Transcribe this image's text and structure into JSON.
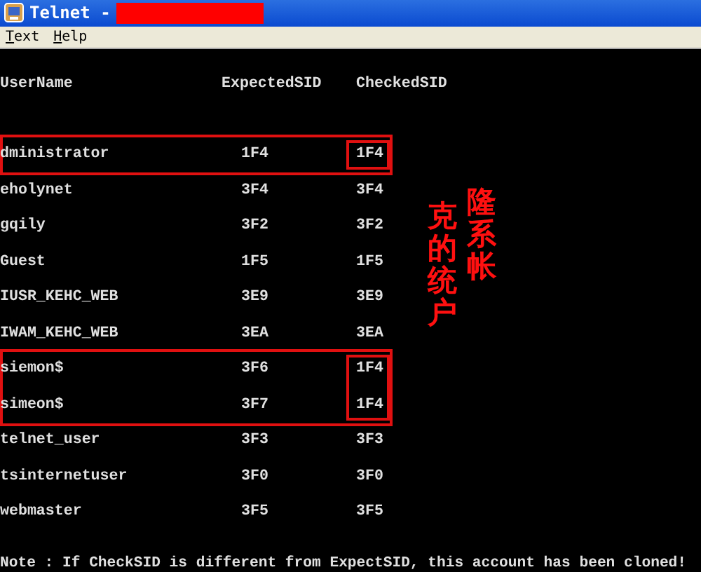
{
  "window": {
    "title": "Telnet -"
  },
  "menu": [
    {
      "label": "Text"
    },
    {
      "label": "Help"
    }
  ],
  "table": {
    "columns": [
      "UserName",
      "ExpectedSID",
      "CheckedSID"
    ],
    "rows": [
      {
        "user": "dministrator",
        "expected": "1F4",
        "checked": "1F4",
        "highlighted": true
      },
      {
        "user": "eholynet",
        "expected": "3F4",
        "checked": "3F4",
        "highlighted": false
      },
      {
        "user": "gqily",
        "expected": "3F2",
        "checked": "3F2",
        "highlighted": false
      },
      {
        "user": "Guest",
        "expected": "1F5",
        "checked": "1F5",
        "highlighted": false
      },
      {
        "user": "IUSR_KEHC_WEB",
        "expected": "3E9",
        "checked": "3E9",
        "highlighted": false
      },
      {
        "user": "IWAM_KEHC_WEB",
        "expected": "3EA",
        "checked": "3EA",
        "highlighted": false
      },
      {
        "user": "siemon$",
        "expected": "3F6",
        "checked": "1F4",
        "highlighted": true
      },
      {
        "user": "simeon$",
        "expected": "3F7",
        "checked": "1F4",
        "highlighted": true
      },
      {
        "user": "telnet_user",
        "expected": "3F3",
        "checked": "3F3",
        "highlighted": false
      },
      {
        "user": "tsinternetuser",
        "expected": "3F0",
        "checked": "3F0",
        "highlighted": false
      },
      {
        "user": "webmaster",
        "expected": "3F5",
        "checked": "3F5",
        "highlighted": false
      }
    ]
  },
  "annotation": "克隆的系统帐户",
  "note": "Note : If CheckSID is different from ExpectSID, this account has been cloned!"
}
